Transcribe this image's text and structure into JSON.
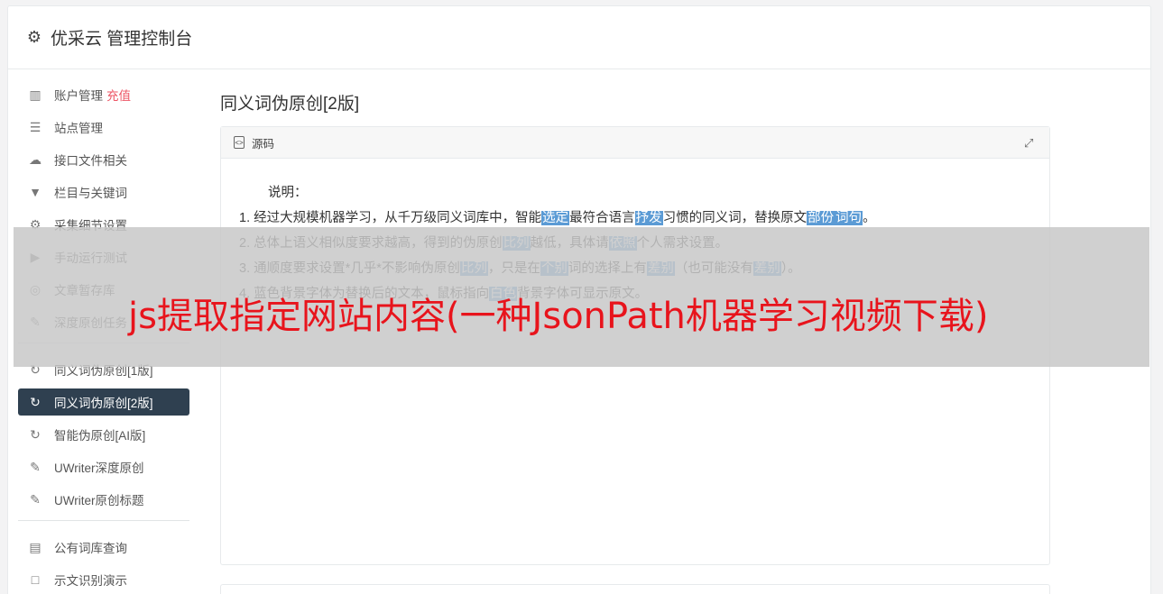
{
  "header": {
    "title": "优采云 管理控制台",
    "icon": "gear-icon"
  },
  "sidebar": {
    "items": [
      {
        "label": "账户管理",
        "extra": "充值",
        "icon": "bar-chart-icon"
      },
      {
        "label": "站点管理",
        "icon": "server-icon"
      },
      {
        "label": "接口文件相关",
        "icon": "cloud-upload-icon"
      },
      {
        "label": "栏目与关键词",
        "icon": "filter-icon"
      },
      {
        "label": "采集细节设置",
        "icon": "cogs-icon"
      },
      {
        "label": "手动运行测试",
        "icon": "play-circle-icon"
      },
      {
        "label": "文章暂存库",
        "icon": "database-icon"
      },
      {
        "label": "深度原创任务",
        "icon": "edit-icon"
      },
      {
        "label": "同义词伪原创[1版]",
        "icon": "refresh-icon"
      },
      {
        "label": "同义词伪原创[2版]",
        "icon": "refresh-icon",
        "active": true
      },
      {
        "label": "智能伪原创[AI版]",
        "icon": "refresh-icon"
      },
      {
        "label": "UWriter深度原创",
        "icon": "edit-icon"
      },
      {
        "label": "UWriter原创标题",
        "icon": "edit-icon"
      },
      {
        "label": "公有词库查询",
        "icon": "book-icon"
      },
      {
        "label": "示文识别演示",
        "icon": "square-icon"
      }
    ]
  },
  "main": {
    "title": "同义词伪原创[2版]",
    "panel": {
      "header": "源码",
      "note_label": "说明：",
      "lines": [
        [
          "1. 经过大规模机器学习，从千万级同义词库中，智能",
          {
            "hl": "选定"
          },
          "最符合语言",
          {
            "hl": "抒发"
          },
          "习惯的同义词，替换原文",
          {
            "hl": "部份"
          },
          {
            "hl": "词句"
          },
          "。"
        ],
        [
          "2. 总体上语义相似度要求越高，得到的伪原创",
          {
            "hl": "比列"
          },
          "越低，具体请",
          {
            "hl": "依照"
          },
          "个人需求设置。"
        ],
        [
          "3. 通顺度要求设置*几乎*不影响伪原创",
          {
            "hl": "比列"
          },
          "，只是在",
          {
            "hl": "个别"
          },
          "词的选择上有",
          {
            "hl": "差别"
          },
          "（也可能没有",
          {
            "hl": "差别"
          },
          "）。"
        ],
        [
          "4. 蓝色背景字体为替换后的文本，鼠标指向",
          {
            "hl": "白色"
          },
          "背景字体可显示原文。"
        ]
      ]
    }
  },
  "overlay": {
    "text": "js提取指定网站内容(一种JsonPath机器学习视频下载)"
  },
  "colors": {
    "active_bg": "#2f4050",
    "highlight": "#5b9bd5",
    "overlay_text": "#e8141c",
    "recharge": "#ed5565"
  }
}
